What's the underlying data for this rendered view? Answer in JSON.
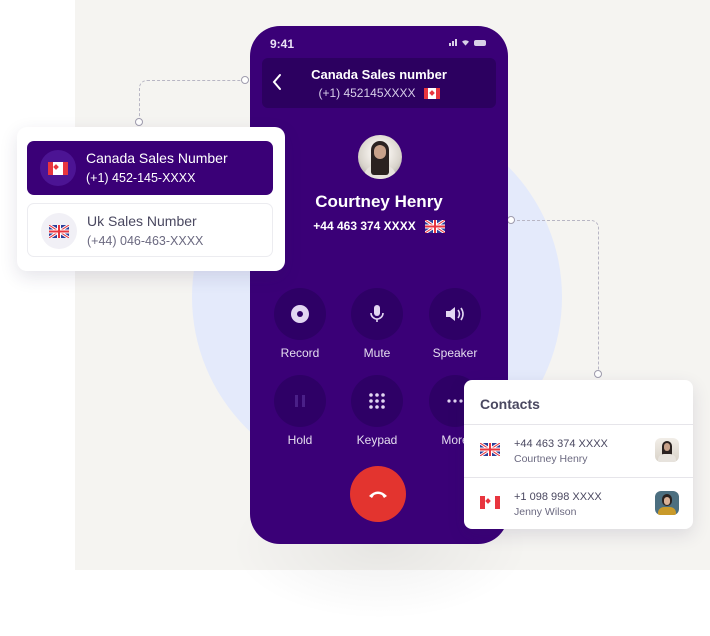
{
  "phone": {
    "status_time": "9:41",
    "header": {
      "title": "Canada Sales number",
      "number": "(+1) 452145XXXX",
      "flag": "canada-flag"
    },
    "caller": {
      "name": "Courtney Henry",
      "number": "+44 463 374 XXXX",
      "flag": "uk-flag"
    },
    "controls": [
      {
        "label": "Record",
        "icon": "record-icon"
      },
      {
        "label": "Mute",
        "icon": "microphone-icon"
      },
      {
        "label": "Speaker",
        "icon": "speaker-icon"
      },
      {
        "label": "Hold",
        "icon": "pause-icon"
      },
      {
        "label": "Keypad",
        "icon": "keypad-icon"
      },
      {
        "label": "More",
        "icon": "more-icon"
      }
    ],
    "end_call_icon": "end-call-icon"
  },
  "sales_numbers": [
    {
      "title": "Canada Sales Number",
      "number": "(+1) 452-145-XXXX",
      "flag": "canada-flag",
      "selected": true
    },
    {
      "title": "Uk Sales Number",
      "number": "(+44) 046-463-XXXX",
      "flag": "uk-flag",
      "selected": false
    }
  ],
  "contacts": {
    "title": "Contacts",
    "items": [
      {
        "number": "+44 463 374 XXXX",
        "name": "Courtney Henry",
        "flag": "uk-flag"
      },
      {
        "number": "+1 098 998 XXXX",
        "name": "Jenny Wilson",
        "flag": "canada-flag"
      }
    ]
  },
  "colors": {
    "primary": "#3a0077",
    "end_call": "#e3342f",
    "background": "#f5f4f1",
    "accent_circle": "#e4eafb"
  }
}
